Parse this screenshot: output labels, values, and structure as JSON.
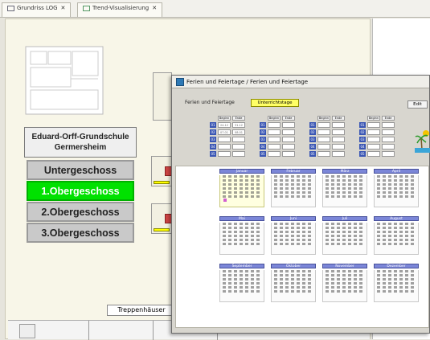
{
  "tabs": [
    {
      "label": "Grundriss LOG",
      "icon": "floorplan-icon"
    },
    {
      "label": "Trend-Visualisierung",
      "icon": "trend-icon"
    }
  ],
  "nav": {
    "school": "Eduard-Orff-Grundschule\nGermersheim",
    "floors": [
      "Untergeschoss",
      "1.Obergeschoss",
      "2.Obergeschoss",
      "3.Obergeschoss"
    ],
    "active_floor": "1.Obergeschoss"
  },
  "stairs_label": "Treppenhäuser",
  "dialog": {
    "title": "Ferien und Feiertage / Ferien und Feiertage",
    "tab_label": "Ferien und Feiertage",
    "active_button": "Unterrichtstage",
    "right_button": "Edit",
    "date_headers": [
      "Beginn",
      "Ende"
    ],
    "date_rows": [
      {
        "num": "01",
        "begin": "24.12",
        "end": "31.12"
      },
      {
        "num": "02",
        "begin": "07.01",
        "end": "08.01"
      },
      {
        "num": "03",
        "begin": "",
        "end": ""
      },
      {
        "num": "04",
        "begin": "",
        "end": ""
      },
      {
        "num": "05",
        "begin": "",
        "end": ""
      }
    ],
    "months": [
      "Januar",
      "Februar",
      "März",
      "April",
      "Mai",
      "Juni",
      "Juli",
      "August",
      "September",
      "Oktober",
      "November",
      "Dezember"
    ]
  },
  "colors": {
    "active_floor": "#00e100",
    "active_button": "#ffff66",
    "month_header": "#7b86d8",
    "date_row_num": "#3a56b4"
  }
}
